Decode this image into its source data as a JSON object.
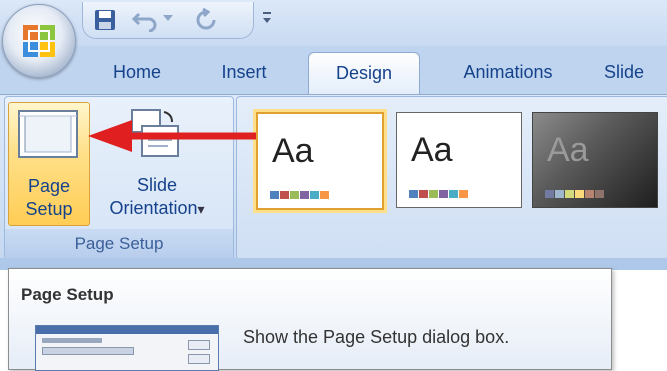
{
  "quick_access": {
    "icons": [
      "save-icon",
      "undo-icon",
      "dropdown-arrow-icon",
      "redo-icon",
      "customize-qat-icon"
    ]
  },
  "tabs": [
    {
      "label": "Home",
      "active": false
    },
    {
      "label": "Insert",
      "active": false
    },
    {
      "label": "Design",
      "active": true
    },
    {
      "label": "Animations",
      "active": false
    },
    {
      "label": "Slide",
      "active": false
    }
  ],
  "ribbon": {
    "page_setup_group": {
      "label": "Page Setup",
      "page_setup_button": {
        "line1": "Page",
        "line2": "Setup"
      },
      "slide_orientation_button": {
        "line1": "Slide",
        "line2": "Orientation",
        "dropdown": "▾"
      }
    },
    "themes": [
      {
        "text": "Aa",
        "swatches": [
          "#4f81bd",
          "#c0504d",
          "#9bbb59",
          "#8064a2",
          "#4bacc6",
          "#f79646"
        ],
        "selected": true
      },
      {
        "text": "Aa",
        "swatches": [
          "#4f81bd",
          "#c0504d",
          "#9bbb59",
          "#8064a2",
          "#4bacc6",
          "#f79646"
        ],
        "selected": false
      },
      {
        "text": "Aa",
        "swatches": [
          "#727ca3",
          "#9fb8cd",
          "#d2da7a",
          "#fada7a",
          "#b88472",
          "#8e736a"
        ],
        "selected": false
      }
    ]
  },
  "tooltip": {
    "title": "Page Setup",
    "description": "Show the Page Setup dialog box."
  },
  "colors": {
    "accent_arrow": "#e02020",
    "tab_text": "#15428b",
    "ribbon_bg": "#cfdff3",
    "highlight": "#ffcd55"
  }
}
